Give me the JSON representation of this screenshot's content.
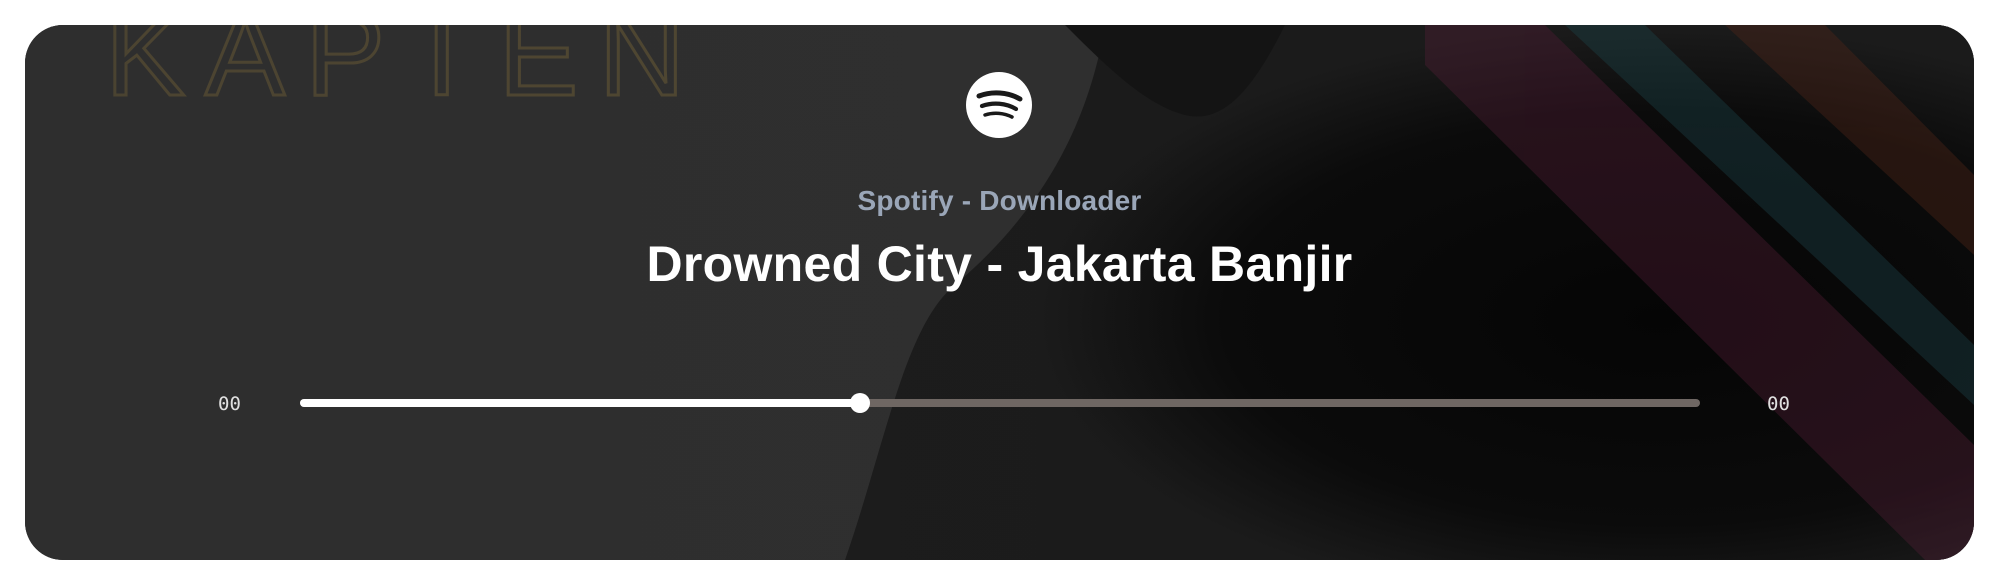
{
  "player": {
    "subtitle": "Spotify - Downloader",
    "title": "Drowned City - Jakarta Banjir",
    "time_current": "00",
    "time_total": "00",
    "progress": 0.4
  },
  "icons": {
    "logo": "spotify-icon"
  },
  "background": {
    "art_lettering": "KAPTEN"
  },
  "colors": {
    "card_background": "#2e2e2e",
    "subtitle": "#9aa6b8",
    "title": "#ffffff",
    "track": "#6f6763",
    "fill": "#ffffff"
  }
}
